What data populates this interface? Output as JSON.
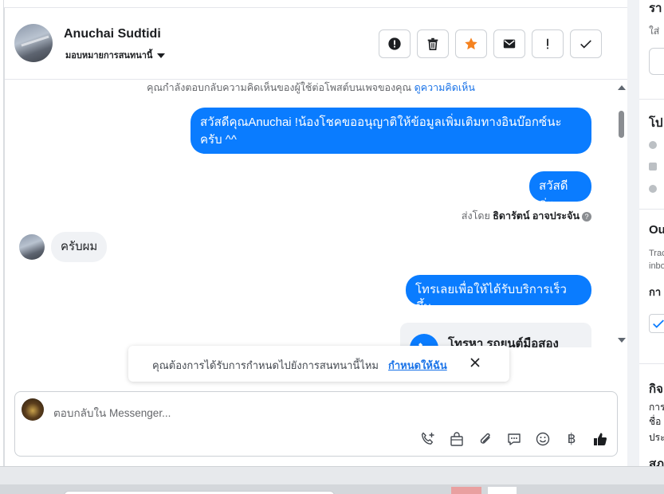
{
  "header": {
    "contact_name": "Anuchai Sudtidi",
    "assign_label": "มอบหมายการสนทนานี้",
    "actions": [
      {
        "icon": "alert-circle-icon",
        "name": "mark-spam-button"
      },
      {
        "icon": "trash-icon",
        "name": "delete-button"
      },
      {
        "icon": "star-icon",
        "name": "star-button"
      },
      {
        "icon": "envelope-icon",
        "name": "mark-unread-button"
      },
      {
        "icon": "exclamation-icon",
        "name": "follow-up-button"
      },
      {
        "icon": "check-icon",
        "name": "mark-done-button"
      }
    ],
    "star_color": "#f5821f"
  },
  "conversation": {
    "notice_text": "คุณกำลังตอบกลับความคิดเห็นของผู้ใช้ต่อโพสต์บนเพจของคุณ",
    "notice_link": "ดูความคิดเห็น",
    "messages": {
      "m1": "สวัสดีคุณAnuchai !น้องโชคขออนุญาติให้ข้อมูลเพิ่มเติมทางอินบ๊อกซ์นะครับ ^^",
      "m2": "สวัสดีค่ะ",
      "m3": "ครับผม",
      "m4": "โทรเลยเพื่อให้ได้รับบริการเร็วขึ้น",
      "card_title": "โทรหา รถยนต์มือสอง"
    },
    "sent_by_prefix": "ส่งโดย",
    "sent_by_name": "ธิดารัตน์ อาจประจัน",
    "bubble_color": "#0a7cff"
  },
  "toast": {
    "message": "คุณต้องการได้รับการกำหนดไปยังการสนทนานี้ไหม",
    "link": "กำหนดให้ฉัน"
  },
  "composer": {
    "placeholder": "ตอบกลับใน Messenger...",
    "tools": [
      "phone-plus-icon",
      "shopping-bag-icon",
      "paperclip-icon",
      "speech-bubble-icon",
      "smiley-icon",
      "baht-icon",
      "thumbs-up-icon"
    ],
    "baht_symbol": "฿"
  },
  "right_panel": {
    "t1": "รา",
    "s1": "ใส่",
    "t2": "โป",
    "t3": "Ou",
    "s3a": "Trac",
    "s3b": "inbo",
    "t4": "กา",
    "t5": "กิจ",
    "s5a": "การ",
    "s5b": "ชื่อ",
    "s5c": "ประ",
    "t6": "สภ"
  }
}
